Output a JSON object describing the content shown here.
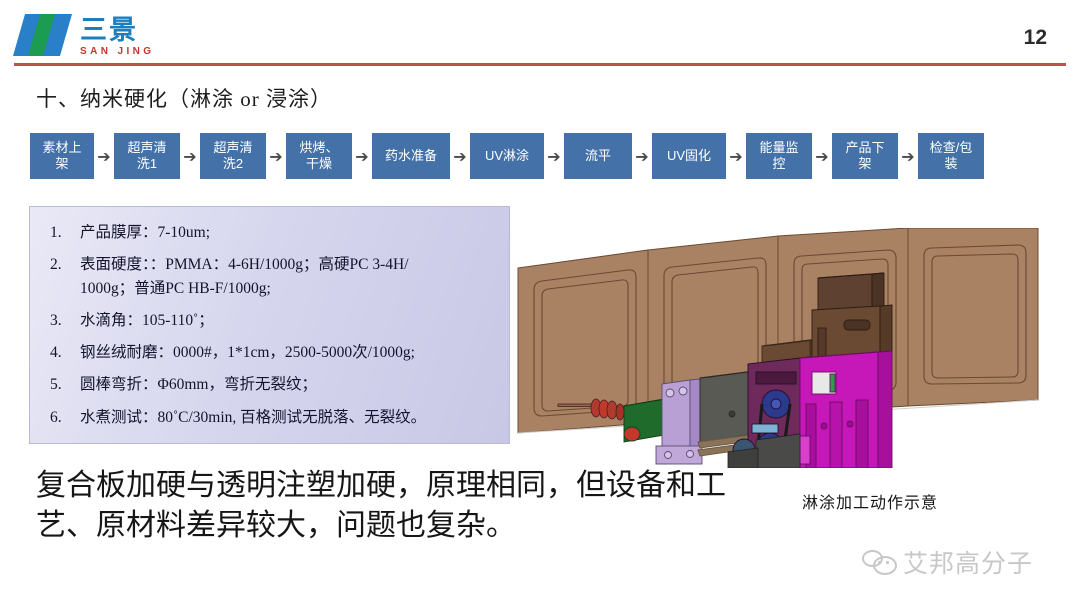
{
  "header": {
    "logo_cn": "三景",
    "logo_en": "SAN JING",
    "page_number": "12"
  },
  "slide": {
    "title": "十、纳米硬化（淋涂 or 浸涂）"
  },
  "process_flow": {
    "arrow_glyph": "➔",
    "steps": [
      {
        "line1": "素材上",
        "line2": "架"
      },
      {
        "line1": "超声清",
        "line2": "洗1"
      },
      {
        "line1": "超声清",
        "line2": "洗2"
      },
      {
        "line1": "烘烤、",
        "line2": "干燥"
      },
      {
        "line1": "药水准备",
        "line2": ""
      },
      {
        "line1": "UV淋涂",
        "line2": ""
      },
      {
        "line1": "流平",
        "line2": ""
      },
      {
        "line1": "UV固化",
        "line2": ""
      },
      {
        "line1": "能量监",
        "line2": "控"
      },
      {
        "line1": "产品下",
        "line2": "架"
      },
      {
        "line1": "检查/包",
        "line2": "装"
      }
    ]
  },
  "specifications": [
    {
      "num": "1.",
      "text": "产品膜厚：7-10um;",
      "cont": ""
    },
    {
      "num": "2.",
      "text": "表面硬度：：PMMA：4-6H/1000g；高硬PC 3-4H/",
      "cont": "1000g；普通PC HB-F/1000g;"
    },
    {
      "num": "3.",
      "text": "水滴角：105-110˚；",
      "cont": ""
    },
    {
      "num": "4.",
      "text": "钢丝绒耐磨：0000#，1*1cm，2500-5000次/1000g;",
      "cont": ""
    },
    {
      "num": "5.",
      "text": "圆棒弯折：Φ60mm，弯折无裂纹；",
      "cont": ""
    },
    {
      "num": "6.",
      "text": "水煮测试：80˚C/30min, 百格测试无脱落、无裂纹。",
      "cont": ""
    }
  ],
  "summary": {
    "paragraph": "复合板加硬与透明注塑加硬，原理相同，但设备和工艺、原材料差异较大，问题也复杂。"
  },
  "figure": {
    "caption": "淋涂加工动作示意"
  },
  "watermark": {
    "text": "艾邦高分子",
    "icon": "wechat-bubble-icon"
  },
  "colors": {
    "flow_box": "#4472a8",
    "header_rule": "#c0504d",
    "logo_blue": "#2a7fc9",
    "logo_green": "#1b9c52",
    "logo_cn_blue": "#1b7fbf",
    "logo_en_red": "#c0392b",
    "spec_box_bg": "#d6d6ee"
  }
}
